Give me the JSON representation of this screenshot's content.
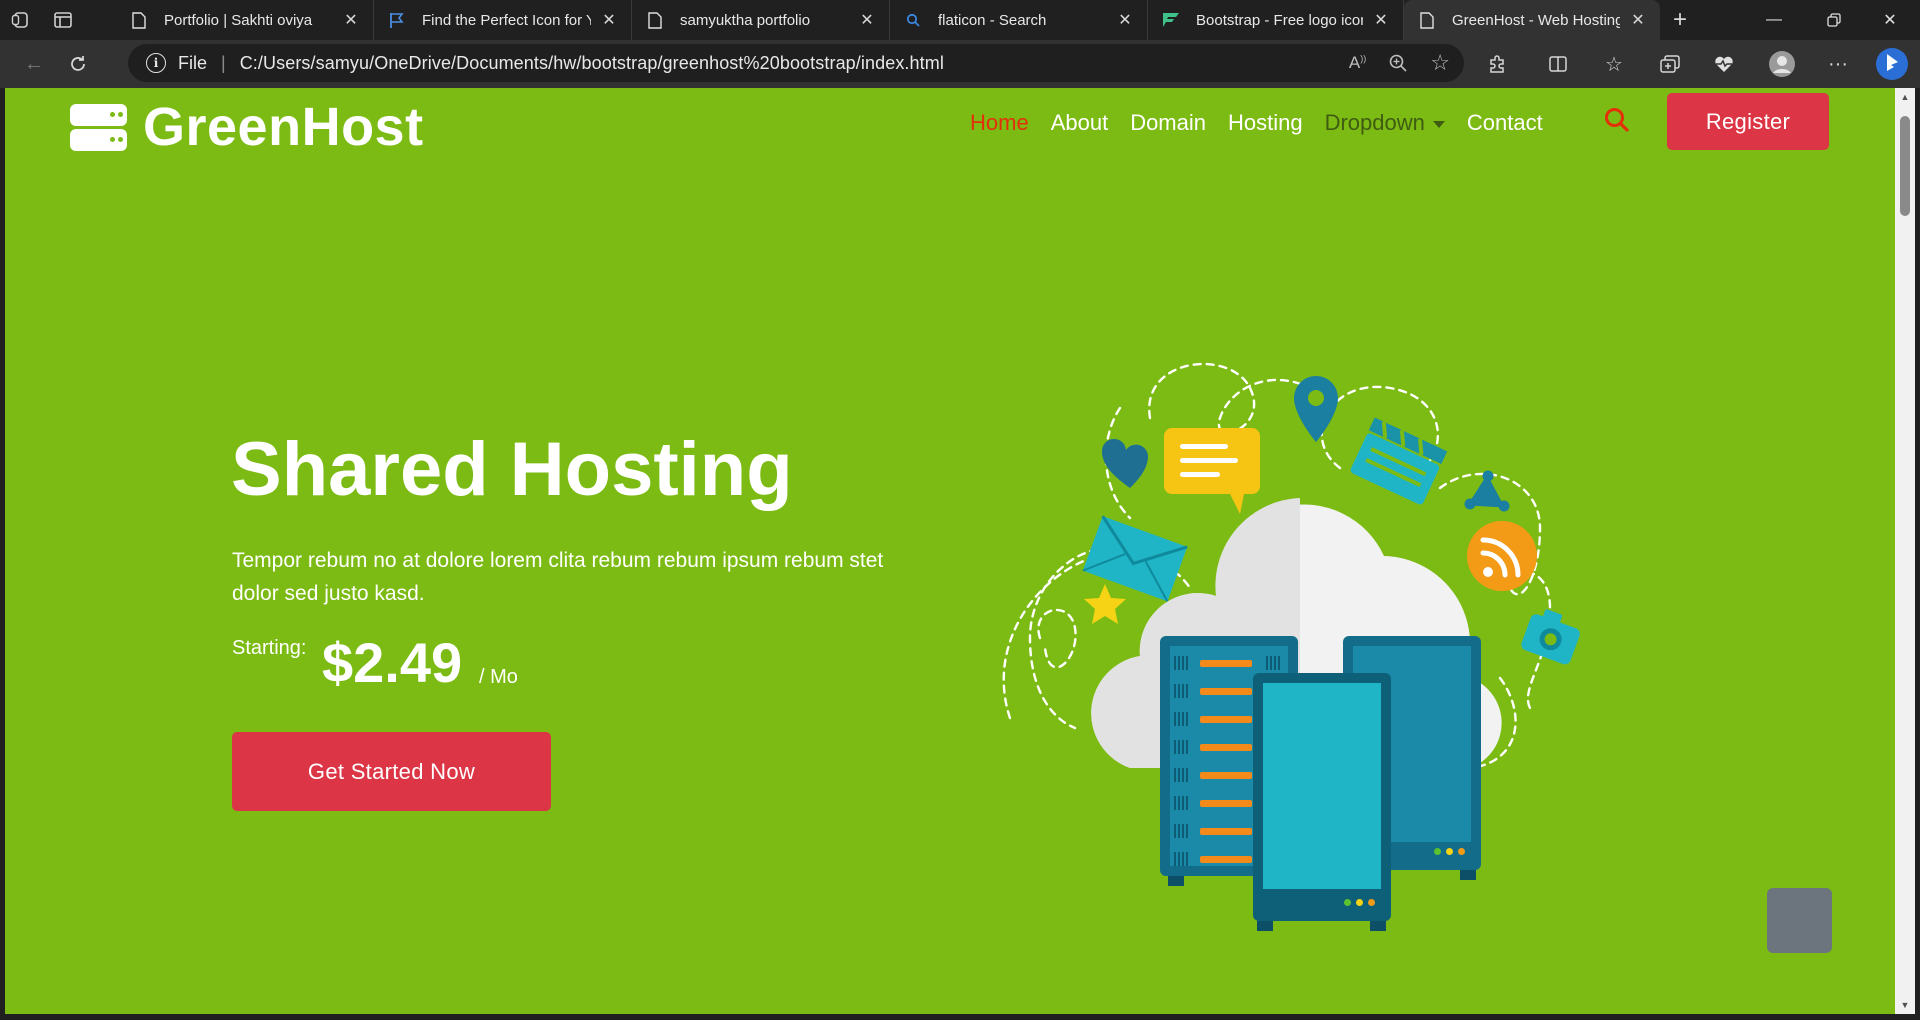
{
  "browser": {
    "tabs": [
      {
        "title": "Portfolio | Sakhti oviya",
        "icon": "page-icon"
      },
      {
        "title": "Find the Perfect Icon for Yo",
        "icon": "flag-icon"
      },
      {
        "title": "samyuktha portfolio",
        "icon": "page-icon"
      },
      {
        "title": "flaticon - Search",
        "icon": "search-icon"
      },
      {
        "title": "Bootstrap - Free logo icon",
        "icon": "flaticon-logo-icon"
      },
      {
        "title": "GreenHost - Web Hosting",
        "icon": "page-icon",
        "active": true
      }
    ],
    "address": {
      "scheme": "File",
      "url": "C:/Users/samyu/OneDrive/Documents/hw/bootstrap/greenhost%20bootstrap/index.html"
    }
  },
  "site": {
    "brand": "GreenHost",
    "nav": {
      "home": "Home",
      "about": "About",
      "domain": "Domain",
      "hosting": "Hosting",
      "dropdown": "Dropdown",
      "contact": "Contact"
    },
    "register_label": "Register",
    "hero": {
      "title": "Shared Hosting",
      "description": "Tempor rebum no at dolore lorem clita rebum rebum ipsum rebum stet dolor sed justo kasd.",
      "price_label": "Starting:",
      "price": "$2.49",
      "price_unit": "/ Mo",
      "cta_label": "Get Started Now"
    }
  },
  "colors": {
    "page_bg": "#7cbb13",
    "accent_red": "#dc3545",
    "active_link": "#e3300b"
  }
}
